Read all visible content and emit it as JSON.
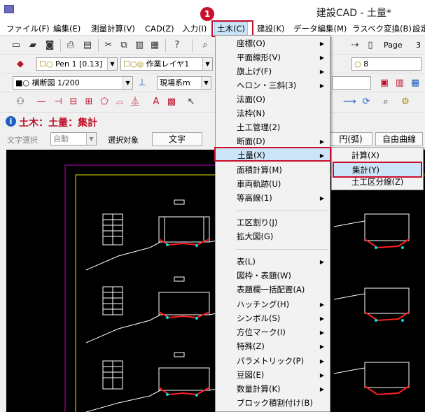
{
  "window": {
    "title": "建設CAD - 土量*"
  },
  "callout": {
    "number": "1"
  },
  "menubar": {
    "items": [
      {
        "label": "ファイル(F)"
      },
      {
        "label": "編集(E)"
      },
      {
        "label": "測量計算(V)"
      },
      {
        "label": "CAD(Z)"
      },
      {
        "label": "入力(I)"
      },
      {
        "label": "土木(C)"
      },
      {
        "label": "建設(K)"
      },
      {
        "label": "データ編集(M)"
      },
      {
        "label": "ラスベク変換(B)"
      },
      {
        "label": "設定"
      }
    ]
  },
  "toolbar1": {
    "page_label": "Page",
    "page_value": "3"
  },
  "toolbar2": {
    "pen_combo": "Pen 1 [0.13]",
    "layer_combo": "作業レイヤ1",
    "layer_num_combo": "8"
  },
  "toolbar3": {
    "view_combo": "横断図 1/200",
    "coord_combo": "現場系m"
  },
  "mode": {
    "icon": "i",
    "title": "土木：土量：集計"
  },
  "optbar": {
    "select_label": "文字選択",
    "select_value": "自動",
    "target_label": "選択対象",
    "text_button": "文字",
    "arc_button": "円(弧)",
    "freecurve_button": "自由曲線"
  },
  "dropdown": {
    "items": [
      {
        "label": "座標(O)",
        "sub": true
      },
      {
        "label": "平面線形(V)",
        "sub": true
      },
      {
        "label": "旗上げ(F)",
        "sub": true
      },
      {
        "label": "ヘロン・三斜(3)",
        "sub": true
      },
      {
        "label": "法面(O)",
        "sub": false
      },
      {
        "label": "法枠(N)",
        "sub": false
      },
      {
        "label": "土工管理(2)",
        "sub": false
      },
      {
        "label": "断面(D)",
        "sub": true
      },
      {
        "label": "土量(X)",
        "sub": true
      },
      {
        "label": "面積計算(M)",
        "sub": false
      },
      {
        "label": "車両軌跡(U)",
        "sub": false
      },
      {
        "label": "等高線(1)",
        "sub": true
      },
      {
        "label": "工区割り(J)",
        "sub": false
      },
      {
        "label": "拡大図(G)",
        "sub": false
      },
      {
        "label": "表(L)",
        "sub": true
      },
      {
        "label": "図枠・表題(W)",
        "sub": false
      },
      {
        "label": "表題欄一括配置(A)",
        "sub": false
      },
      {
        "label": "ハッチング(H)",
        "sub": true
      },
      {
        "label": "シンボル(S)",
        "sub": true
      },
      {
        "label": "方位マーク(I)",
        "sub": true
      },
      {
        "label": "特殊(Z)",
        "sub": true
      },
      {
        "label": "パラメトリック(P)",
        "sub": true
      },
      {
        "label": "豆図(E)",
        "sub": true
      },
      {
        "label": "数量計算(K)",
        "sub": true
      },
      {
        "label": "ブロック積割付け(B)",
        "sub": false
      }
    ]
  },
  "submenu": {
    "items": [
      {
        "label": "計算(X)"
      },
      {
        "label": "集計(Y)"
      },
      {
        "label": "土工区分線(Z)"
      }
    ]
  },
  "colors": {
    "highlight": "#c8102e",
    "hover": "#cce4f7",
    "mode_title": "#c0102a"
  }
}
